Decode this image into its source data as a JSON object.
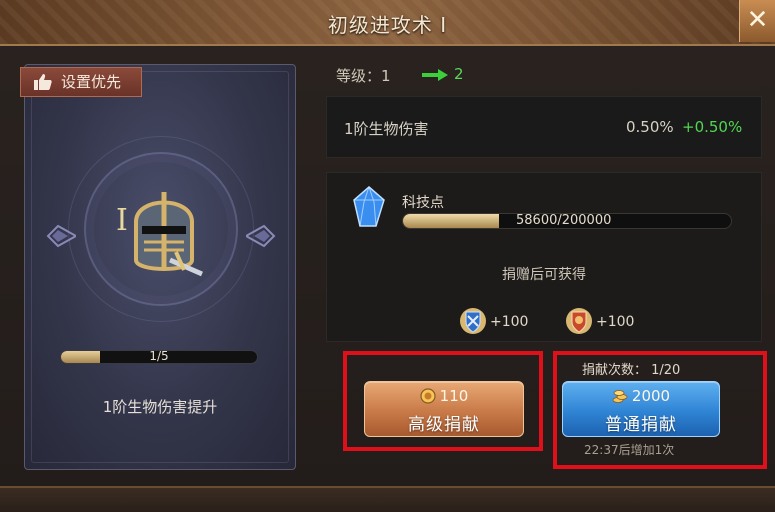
{
  "header": {
    "title": "初级进攻术 Ⅰ"
  },
  "left": {
    "priority_label": "设置优先",
    "level_progress_text": "1/5",
    "level_progress_fraction": 0.2,
    "effect_description": "1阶生物伤害提升"
  },
  "level": {
    "label": "等级：1",
    "next": "2"
  },
  "stat": {
    "name": "1阶生物伤害",
    "current": "0.50%",
    "increase": "+0.50%"
  },
  "tech": {
    "label": "科技点",
    "progress_text": "58600/200000",
    "progress_fraction": 0.293,
    "reward_label": "捐赠后可获得",
    "rewards": [
      {
        "icon": "blue-crest-icon",
        "amount": "+100"
      },
      {
        "icon": "red-crest-icon",
        "amount": "+100"
      }
    ]
  },
  "advanced_donate": {
    "cost": "110",
    "label": "高级捐献",
    "cost_icon": "gold-coin-icon"
  },
  "normal_donate": {
    "count_label": "捐献次数：  1/20",
    "cost": "2000",
    "label": "普通捐献",
    "cost_icon": "coin-stack-icon",
    "refresh_text": "22:37后增加1次"
  },
  "colors": {
    "highlight": "#e0101a",
    "positive": "#52d652",
    "advanced_button": "#c87a48",
    "normal_button": "#2f84d4"
  }
}
